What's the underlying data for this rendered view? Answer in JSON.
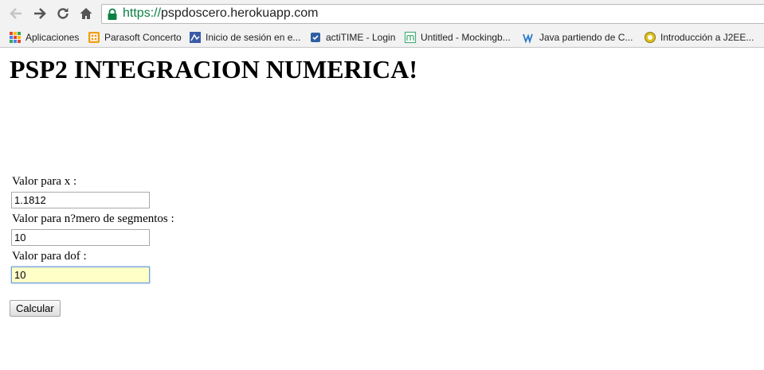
{
  "browser": {
    "url_scheme": "https://",
    "url_host": "pspdoscero.herokuapp.com",
    "bookmarks": [
      {
        "label": "Aplicaciones",
        "icon": "apps-grid-icon"
      },
      {
        "label": "Parasoft Concerto",
        "icon": "parasoft-icon"
      },
      {
        "label": "Inicio de sesión en e...",
        "icon": "login-page-icon"
      },
      {
        "label": "actiTIME - Login",
        "icon": "actitime-icon"
      },
      {
        "label": "Untitled - Mockingb...",
        "icon": "mockingbird-icon"
      },
      {
        "label": "Java partiendo de C...",
        "icon": "wordpress-icon"
      },
      {
        "label": "Introducción a J2EE...",
        "icon": "j2ee-icon"
      }
    ]
  },
  "page": {
    "title": "PSP2 INTEGRACION NUMERICA!",
    "fields": [
      {
        "label": "Valor para x :",
        "value": "1.1812"
      },
      {
        "label": "Valor para n?mero de segmentos :",
        "value": "10"
      },
      {
        "label": "Valor para dof :",
        "value": "10"
      }
    ],
    "submit_label": "Calcular"
  },
  "colors": {
    "scheme_green": "#0b8043",
    "focused_field_bg": "#ffffc8"
  }
}
